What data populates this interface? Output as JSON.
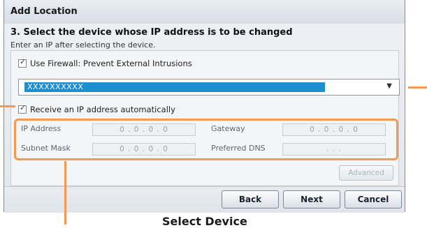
{
  "dialog": {
    "title": "Add Location",
    "step": "3. Select the device whose IP address is to be changed",
    "hint": "Enter an IP after selecting the device."
  },
  "firewall": {
    "label": "Use Firewall: Prevent External Intrusions",
    "checked": true
  },
  "device_select": {
    "value": "XXXXXXXXXX"
  },
  "auto_ip": {
    "label": "Receive an IP address automatically",
    "checked": true
  },
  "fields": {
    "ip_address": {
      "label": "IP Address",
      "value": "0 . 0 . 0 . 0"
    },
    "gateway": {
      "label": "Gateway",
      "value": "0 . 0 . 0 . 0"
    },
    "subnet_mask": {
      "label": "Subnet Mask",
      "value": "0 . 0 . 0 . 0"
    },
    "preferred_dns": {
      "label": "Preferred DNS",
      "value": ". . ."
    }
  },
  "buttons": {
    "advanced": "Advanced",
    "back": "Back",
    "next": "Next",
    "cancel": "Cancel"
  },
  "caption": "Select Device",
  "colors": {
    "accent": "#f29a55",
    "selection": "#1d8fd0"
  }
}
